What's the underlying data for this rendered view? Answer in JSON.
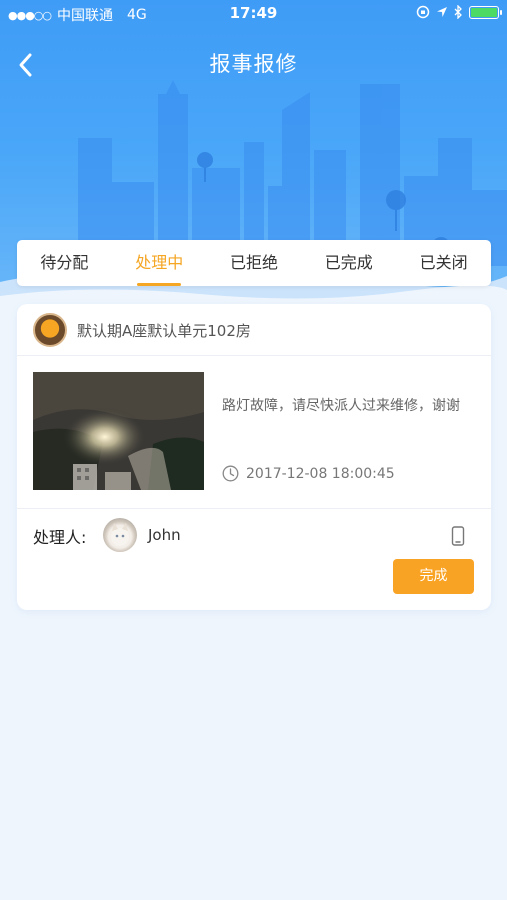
{
  "status_bar": {
    "signal": "●●●○○",
    "carrier": "中国联通",
    "network": "4G",
    "time": "17:49"
  },
  "header": {
    "title": "报事报修",
    "back_icon": "chevron-left-icon"
  },
  "tabs": [
    {
      "label": "待分配",
      "active": false
    },
    {
      "label": "处理中",
      "active": true
    },
    {
      "label": "已拒绝",
      "active": false
    },
    {
      "label": "已完成",
      "active": false
    },
    {
      "label": "已关闭",
      "active": false
    }
  ],
  "report": {
    "location": "默认期A座默认单元102房",
    "description": "路灯故障，请尽快派人过来维修，谢谢",
    "time": "2017-12-08 18:00:45",
    "handler_label": "处理人:",
    "handler_name": "John",
    "done_label": "完成"
  },
  "colors": {
    "accent": "#f5a623",
    "header_blue": "#3f9cf6",
    "button_orange": "#f9a325"
  }
}
